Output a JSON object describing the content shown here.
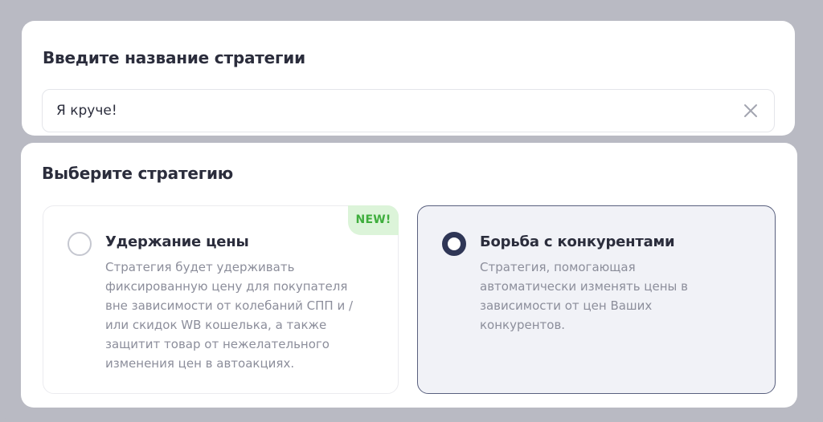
{
  "name_section": {
    "title": "Введите название стратегии",
    "input_value": "Я круче!",
    "clear_icon": "close-icon"
  },
  "strategy_section": {
    "title": "Выберите стратегию",
    "options": [
      {
        "title": "Удержание цены",
        "description": "Стратегия будет удерживать\nфиксированную цену для покупателя\nвне зависимости от колебаний СПП и /\nили скидок WB кошелька, а также\nзащитит товар от нежелательного\nизменения цен в автоакциях.",
        "badge": "NEW!",
        "selected": false
      },
      {
        "title": "Борьба с конкурентами",
        "description": "Стратегия, помогающая\nавтоматически изменять цены в\nзависимости от цен Ваших\nконкурентов.",
        "selected": true
      }
    ]
  },
  "colors": {
    "backdrop": "#b9bac3",
    "text_primary": "#2b2d3c",
    "text_secondary": "#8c8e9b",
    "selected_border": "#59607e",
    "selected_bg": "#f1f2f7",
    "badge_bg": "#dcf4d9",
    "badge_text": "#3fae3d"
  }
}
